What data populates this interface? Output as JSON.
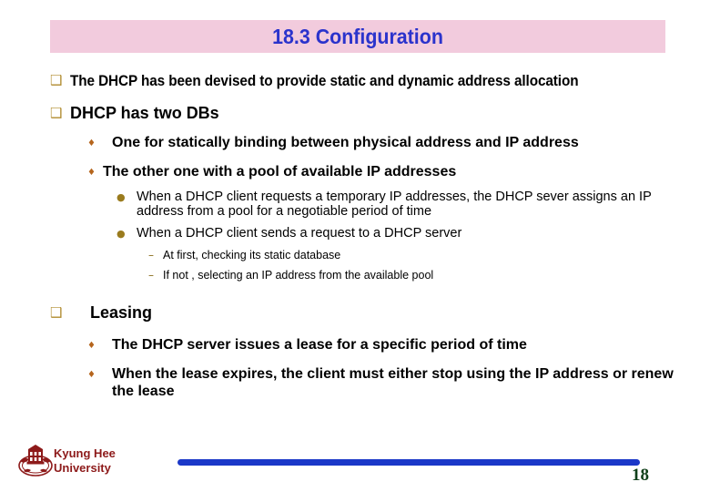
{
  "slide": {
    "title": "18.3 Configuration",
    "title_band_color": "#f2cbdd",
    "title_color": "#2b33cc"
  },
  "bullets": {
    "square_glyph": "❑",
    "diamond_glyph": "♦",
    "round_glyph": "●",
    "dash_glyph": "–",
    "square_color": "#b08b2e",
    "diamond_color": "#b5651d",
    "round_color": "#9a7b1e",
    "dash_color": "#8a6d1c"
  },
  "content": {
    "item1": "The DHCP has been devised to provide static and dynamic address allocation",
    "item2": "DHCP has two DBs",
    "item2_sub1": "One for statically binding between physical address and IP address",
    "item2_sub2": "The other one with a pool of available IP addresses",
    "item2_sub2_a": "When a DHCP client requests a temporary IP addresses, the DHCP sever assigns an IP address from a pool for a negotiable period of time",
    "item2_sub2_b": "When a DHCP client sends a request to a DHCP server",
    "item2_sub2_b_i": "At first, checking its static database",
    "item2_sub2_b_ii": "If not , selecting an IP address from the available pool",
    "item3": "Leasing",
    "item3_sub1": "The DHCP server issues a lease for a specific period of time",
    "item3_sub2": "When the lease expires, the client must either stop using the IP address or renew the lease"
  },
  "footer": {
    "university_line1": "Kyung Hee",
    "university_line2": "University",
    "page_number": "18",
    "rule_color": "#1b38c8",
    "university_color": "#8d1a1a",
    "page_number_color": "#10401a"
  }
}
